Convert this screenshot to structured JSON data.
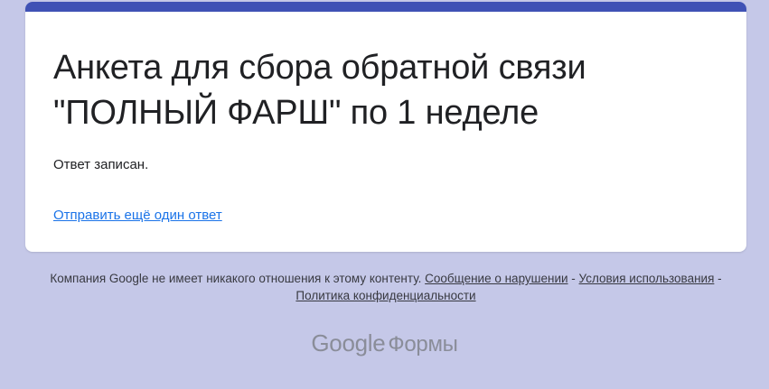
{
  "form": {
    "title_line1": "Анкета для сбора обратной связи",
    "title_line2": "\"ПОЛНЫЙ ФАРШ\" по 1 неделе",
    "response_recorded": "Ответ записан.",
    "submit_another": "Отправить ещё один ответ",
    "accent_color": "#3f51b5"
  },
  "footer": {
    "disclaimer": "Компания Google не имеет никакого отношения к этому контенту.",
    "report_abuse": "Сообщение о нарушении",
    "separator": " - ",
    "terms": "Условия использования",
    "privacy": "Политика конфиденциальности"
  },
  "brand": {
    "google": "Google",
    "product": "Формы"
  },
  "colors": {
    "background": "#c5c8e8",
    "link": "#1a73e8"
  }
}
